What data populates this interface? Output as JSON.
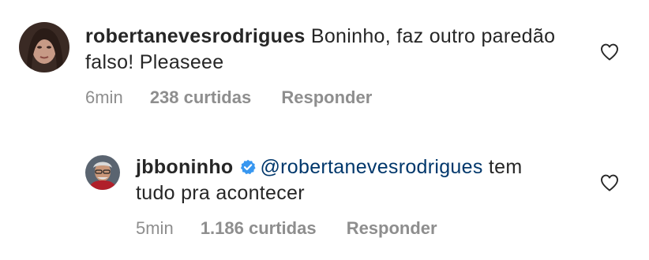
{
  "comments": [
    {
      "username": "robertanevesrodrigues",
      "text": "Boninho, faz outro paredão falso! Pleaseee",
      "time": "6min",
      "likes": "238 curtidas",
      "reply_label": "Responder"
    }
  ],
  "reply": {
    "username": "jbboninho",
    "verified": true,
    "mention": "@robertanevesrodrigues",
    "text": "tem tudo pra acontecer",
    "time": "5min",
    "likes": "1.186 curtidas",
    "reply_label": "Responder"
  },
  "colors": {
    "text": "#262626",
    "muted": "#8e8e8e",
    "mention": "#00376b",
    "verified": "#3897f0"
  },
  "icons": {
    "like": "heart-outline-icon",
    "verified": "verified-badge-icon"
  }
}
